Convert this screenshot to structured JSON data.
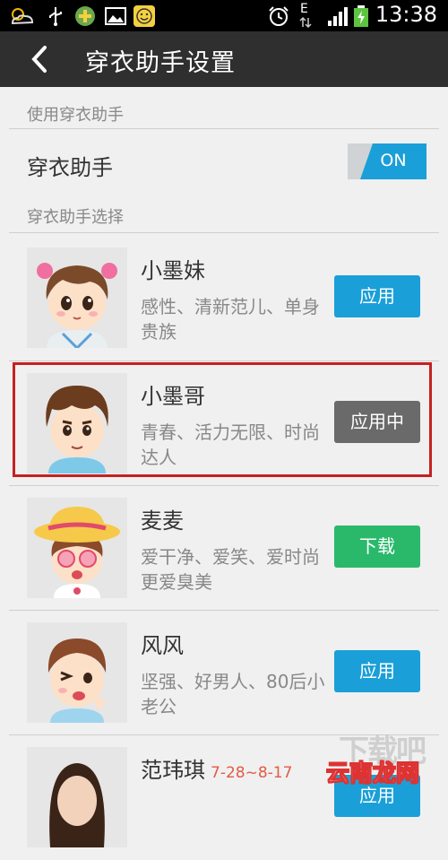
{
  "status_bar": {
    "time": "13:38",
    "network_label": "E",
    "left_icons": [
      "weather-icon",
      "usb-icon",
      "app-badge-icon",
      "gallery-icon",
      "smiley-icon"
    ],
    "right_icons": [
      "alarm-icon",
      "data-arrows-icon",
      "signal-icon",
      "battery-charging-icon"
    ]
  },
  "title_bar": {
    "title": "穿衣助手设置"
  },
  "sections": {
    "use_header": "使用穿衣助手",
    "toggle_label": "穿衣助手",
    "toggle_state": "ON",
    "select_header": "穿衣助手选择"
  },
  "assistants": [
    {
      "name": "小墨妹",
      "date": "",
      "desc": "感性、清新范儿、单身贵族",
      "button": "应用",
      "button_style": "blue"
    },
    {
      "name": "小墨哥",
      "date": "",
      "desc": "青春、活力无限、时尚达人",
      "button": "应用中",
      "button_style": "gray"
    },
    {
      "name": "麦麦",
      "date": "",
      "desc": "爱干净、爱笑、爱时尚更爱臭美",
      "button": "下载",
      "button_style": "green"
    },
    {
      "name": "风风",
      "date": "",
      "desc": "坚强、好男人、80后小老公",
      "button": "应用",
      "button_style": "blue"
    },
    {
      "name": "范玮琪",
      "date": "7-28~8-17",
      "desc": "",
      "button": "应用",
      "button_style": "blue"
    }
  ],
  "watermarks": {
    "site": "云南龙网",
    "overlay": "下载吧"
  },
  "colors": {
    "accent_blue": "#1a9fd8",
    "active_gray": "#6a6a6a",
    "download_green": "#2ab96b",
    "highlight_red": "#c62020",
    "date_red": "#e25b45"
  }
}
